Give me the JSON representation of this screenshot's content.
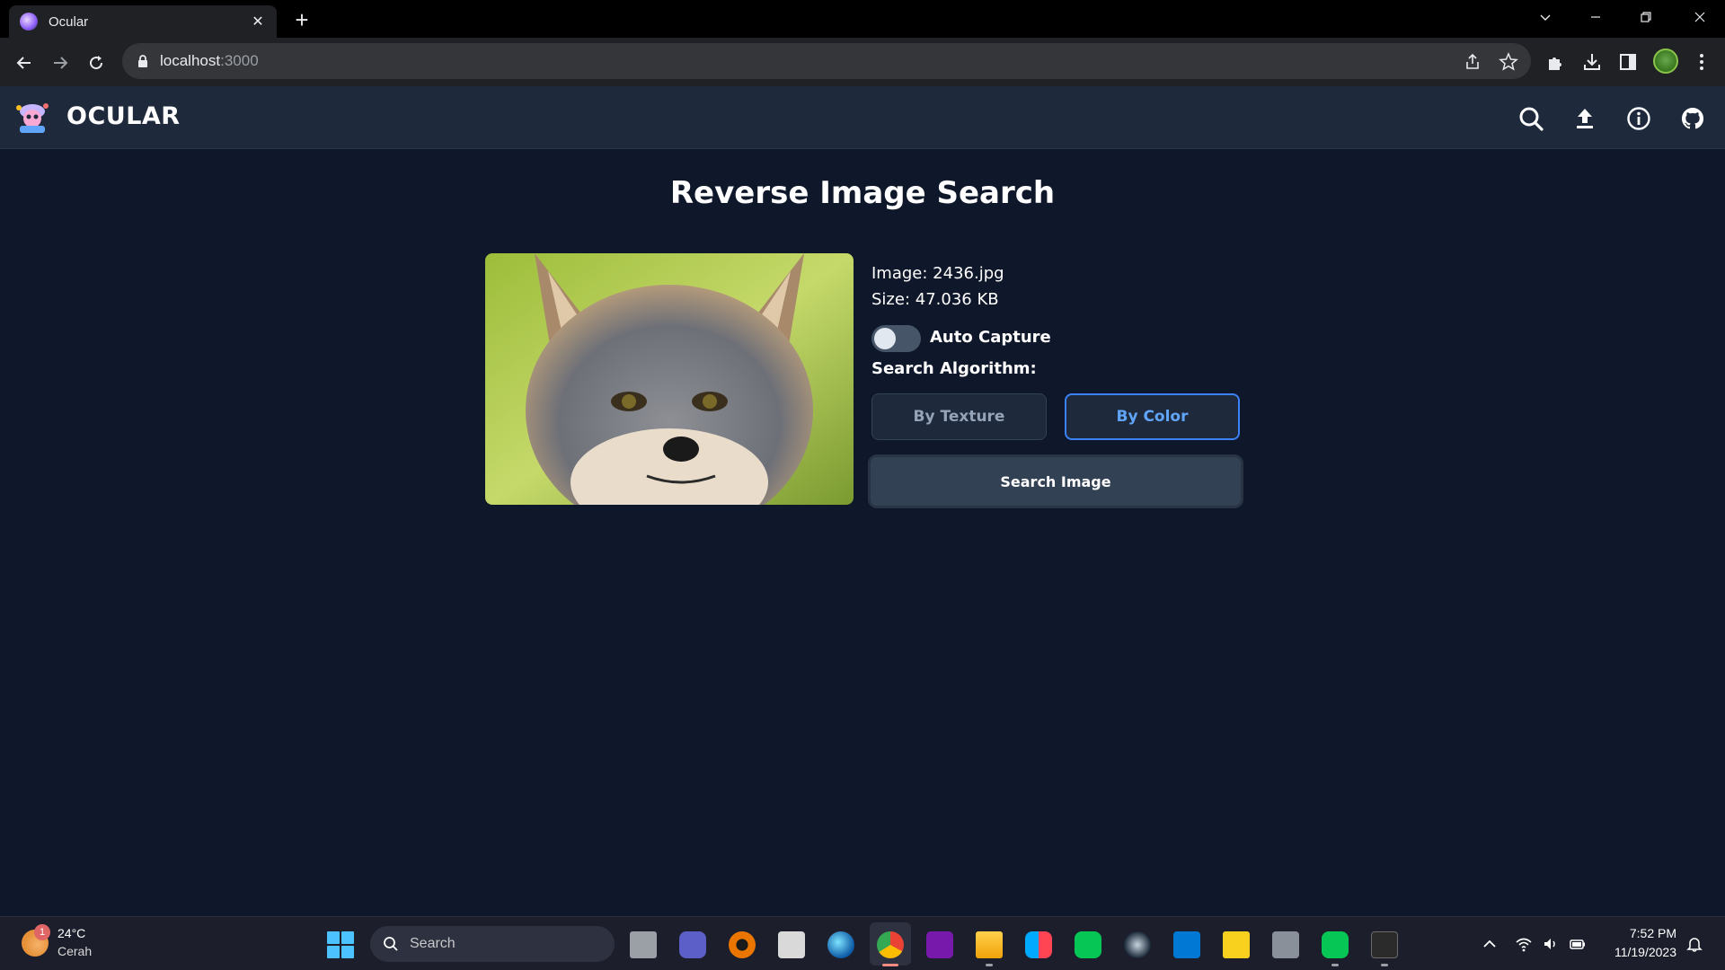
{
  "browser": {
    "tab_title": "Ocular",
    "url_host": "localhost",
    "url_port": ":3000"
  },
  "app": {
    "brand": "OCULAR",
    "header_icons": [
      "search-icon",
      "upload-icon",
      "info-icon",
      "github-icon"
    ]
  },
  "main": {
    "title": "Reverse Image Search",
    "image_label": "Image: 2436.jpg",
    "size_label": "Size: 47.036 KB",
    "auto_capture_label": "Auto Capture",
    "auto_capture_on": false,
    "algorithm_label": "Search Algorithm:",
    "algo_texture": "By Texture",
    "algo_color": "By Color",
    "algo_selected": "By Color",
    "search_button": "Search Image"
  },
  "taskbar": {
    "weather_temp": "24°C",
    "weather_cond": "Cerah",
    "weather_badge": "1",
    "search_text": "Search",
    "time": "7:52 PM",
    "date": "11/19/2023"
  },
  "colors": {
    "background": "#0f172a",
    "header": "#1e293b",
    "accent": "#3b82f6"
  }
}
